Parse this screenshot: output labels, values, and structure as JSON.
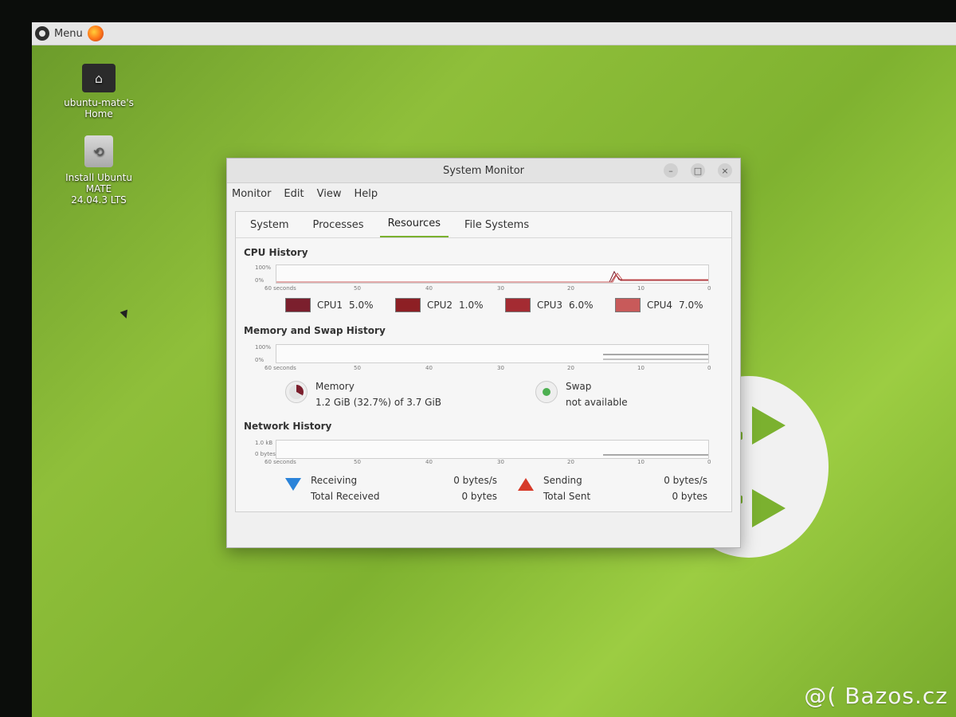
{
  "topbar": {
    "menu_label": "Menu"
  },
  "desktop": {
    "icons": [
      {
        "label": "ubuntu-mate's\nHome"
      },
      {
        "label": "Install Ubuntu MATE\n24.04.3 LTS"
      }
    ]
  },
  "window": {
    "title": "System Monitor",
    "menu": [
      "Monitor",
      "Edit",
      "View",
      "Help"
    ],
    "tabs": [
      "System",
      "Processes",
      "Resources",
      "File Systems"
    ],
    "active_tab": "Resources",
    "cpu": {
      "section_title": "CPU History",
      "y_top": "100%",
      "y_bottom": "0%",
      "x_labels": [
        "60 seconds",
        "50",
        "40",
        "30",
        "20",
        "10",
        "0"
      ],
      "legend": [
        {
          "label": "CPU1",
          "value": "5.0%",
          "color": "#7b1f2d"
        },
        {
          "label": "CPU2",
          "value": "1.0%",
          "color": "#8d1f24"
        },
        {
          "label": "CPU3",
          "value": "6.0%",
          "color": "#a42b32"
        },
        {
          "label": "CPU4",
          "value": "7.0%",
          "color": "#c85a5a"
        }
      ]
    },
    "memory": {
      "section_title": "Memory and Swap History",
      "y_top": "100%",
      "y_bottom": "0%",
      "x_labels": [
        "60 seconds",
        "50",
        "40",
        "30",
        "20",
        "10",
        "0"
      ],
      "memory_label": "Memory",
      "memory_value": "1.2 GiB (32.7%) of 3.7 GiB",
      "swap_label": "Swap",
      "swap_value": "not available"
    },
    "network": {
      "section_title": "Network History",
      "y_top": "1.0 kB",
      "y_bottom": "0 bytes",
      "x_labels": [
        "60 seconds",
        "50",
        "40",
        "30",
        "20",
        "10",
        "0"
      ],
      "receiving_label": "Receiving",
      "receiving_value": "0 bytes/s",
      "total_received_label": "Total Received",
      "total_received_value": "0 bytes",
      "sending_label": "Sending",
      "sending_value": "0 bytes/s",
      "total_sent_label": "Total Sent",
      "total_sent_value": "0 bytes"
    }
  },
  "watermark": "@( Bazos.cz"
}
